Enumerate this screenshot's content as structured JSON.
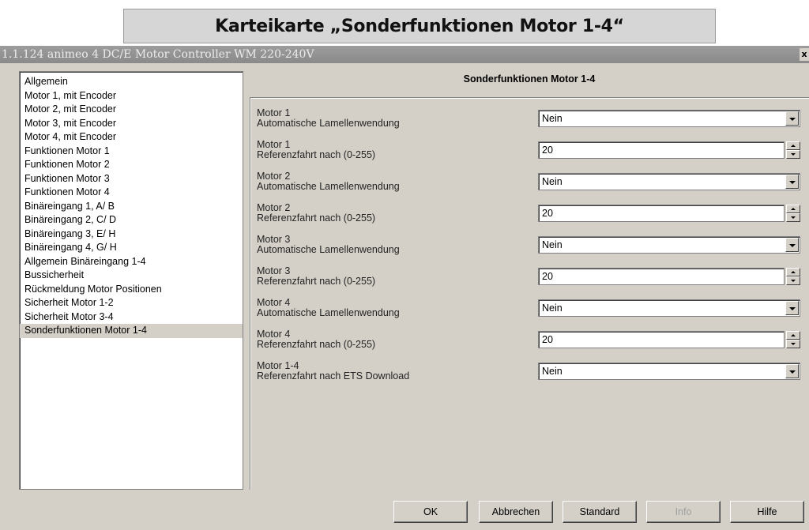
{
  "banner": {
    "title": "Karteikarte „Sonderfunktionen Motor 1-4“"
  },
  "window": {
    "title": "1.1.124 animeo 4 DC/E Motor Controller WM 220-240V",
    "close_label": "x"
  },
  "sidebar": {
    "items": [
      {
        "label": "Allgemein"
      },
      {
        "label": "Motor 1, mit Encoder"
      },
      {
        "label": "Motor 2, mit Encoder"
      },
      {
        "label": "Motor 3, mit Encoder"
      },
      {
        "label": "Motor 4, mit Encoder"
      },
      {
        "label": "Funktionen Motor 1"
      },
      {
        "label": "Funktionen Motor 2"
      },
      {
        "label": "Funktionen Motor 3"
      },
      {
        "label": "Funktionen Motor 4"
      },
      {
        "label": "Binäreingang 1, A/ B"
      },
      {
        "label": "Binäreingang 2, C/ D"
      },
      {
        "label": "Binäreingang 3, E/ H"
      },
      {
        "label": "Binäreingang 4, G/ H"
      },
      {
        "label": "Allgemein Binäreingang 1-4"
      },
      {
        "label": "Bussicherheit"
      },
      {
        "label": "Rückmeldung Motor Positionen"
      },
      {
        "label": "Sicherheit Motor 1-2"
      },
      {
        "label": "Sicherheit Motor 3-4"
      },
      {
        "label": "Sonderfunktionen Motor 1-4"
      }
    ],
    "selected_index": 18
  },
  "main": {
    "title": "Sonderfunktionen Motor 1-4",
    "params": [
      {
        "line1": "Motor 1",
        "line2": "Automatische Lamellenwendung",
        "type": "select",
        "value": "Nein"
      },
      {
        "line1": "Motor 1",
        "line2": "Referenzfahrt nach (0-255)",
        "type": "spin",
        "value": "20"
      },
      {
        "line1": "Motor 2",
        "line2": "Automatische Lamellenwendung",
        "type": "select",
        "value": "Nein"
      },
      {
        "line1": "Motor 2",
        "line2": "Referenzfahrt nach (0-255)",
        "type": "spin",
        "value": "20"
      },
      {
        "line1": "Motor 3",
        "line2": "Automatische Lamellenwendung",
        "type": "select",
        "value": "Nein"
      },
      {
        "line1": "Motor 3",
        "line2": "Referenzfahrt nach (0-255)",
        "type": "spin",
        "value": "20"
      },
      {
        "line1": "Motor 4",
        "line2": "Automatische Lamellenwendung",
        "type": "select",
        "value": "Nein"
      },
      {
        "line1": "Motor 4",
        "line2": "Referenzfahrt nach (0-255)",
        "type": "spin",
        "value": "20"
      },
      {
        "line1": "Motor 1-4",
        "line2": "Referenzfahrt nach ETS Download",
        "type": "select",
        "value": "Nein"
      }
    ]
  },
  "buttons": {
    "ok": "OK",
    "cancel": "Abbrechen",
    "standard": "Standard",
    "info": "Info",
    "help": "Hilfe"
  }
}
